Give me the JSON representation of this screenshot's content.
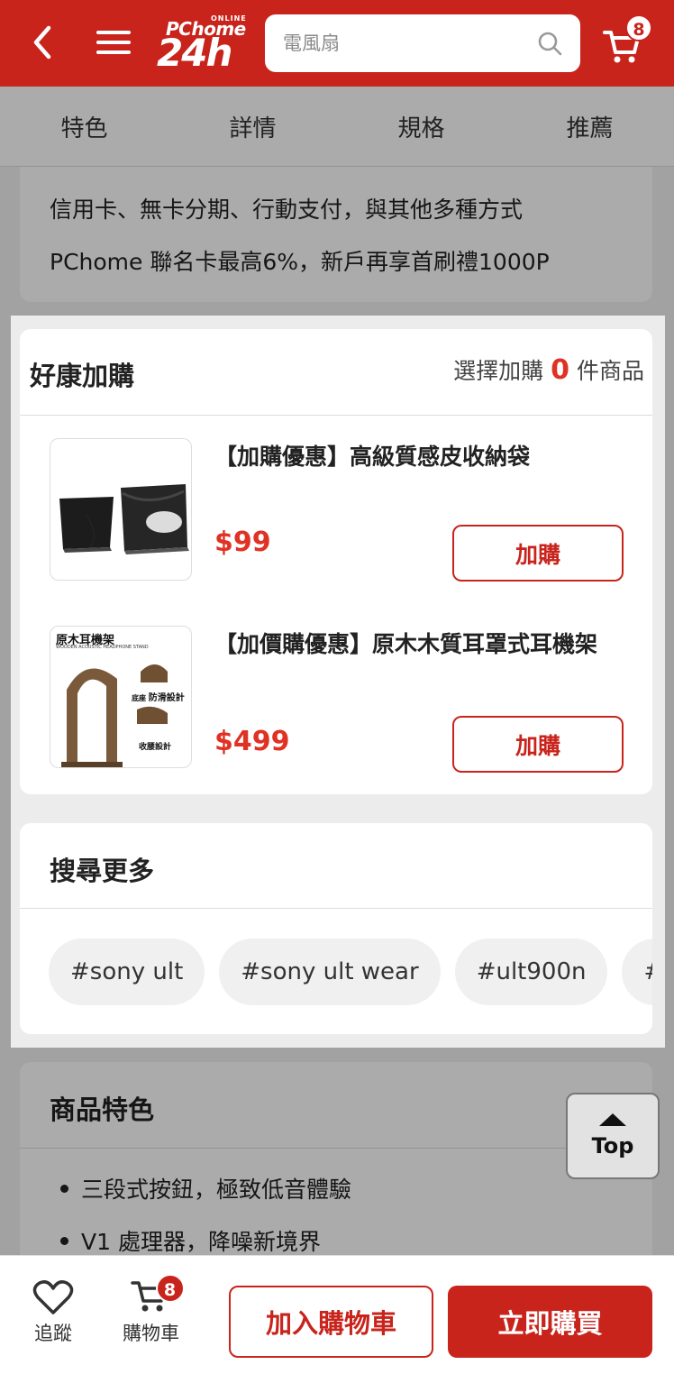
{
  "header": {
    "logo_online": "ONLINE",
    "logo_brand": "PChome",
    "logo_24h": "24h",
    "search_placeholder": "電風扇",
    "cart_count": "8"
  },
  "tabs": [
    "特色",
    "詳情",
    "規格",
    "推薦"
  ],
  "payment": {
    "line1": "信用卡、無卡分期、行動支付，與其他多種方式",
    "line2": "PChome 聯名卡最高6%，新戶再享首刷禮1000P"
  },
  "addon": {
    "title": "好康加購",
    "count_prefix": "選擇加購",
    "count": "0",
    "count_suffix": "件商品",
    "items": [
      {
        "title": "【加購優惠】高級質感皮收納袋",
        "price": "$99",
        "button": "加購"
      },
      {
        "title": "【加價購優惠】原木木質耳罩式耳機架",
        "price": "$499",
        "button": "加購"
      }
    ],
    "item2_thumb": {
      "title": "原木耳機架",
      "subtitle": "WOODEN ACOUSTIC HEADPHONE STAND",
      "tag1": "底座",
      "tag1b": "防滑設計",
      "tag2": "收腰設計"
    }
  },
  "search_more": {
    "title": "搜尋更多",
    "chips": [
      "#sony ult",
      "#sony ult wear",
      "#ult900n",
      "#s"
    ]
  },
  "features": {
    "title": "商品特色",
    "items": [
      "三段式按鈕，極致低音體驗",
      "V1 處理器，降噪新境界"
    ]
  },
  "top_button": "Top",
  "bottom_bar": {
    "track": "追蹤",
    "cart": "購物車",
    "cart_count": "8",
    "add_to_cart": "加入購物車",
    "buy_now": "立即購買"
  },
  "colors": {
    "brand": "#c8241c",
    "price": "#e03224"
  }
}
